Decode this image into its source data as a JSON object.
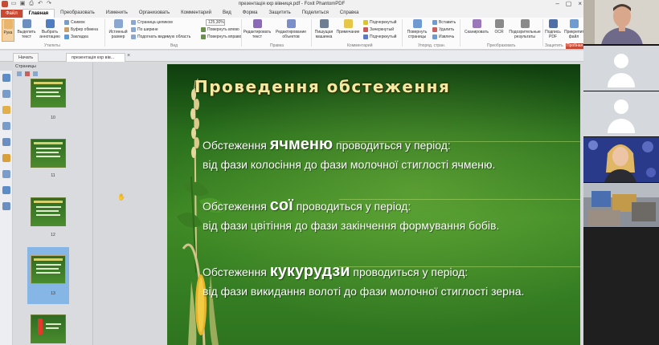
{
  "titlebar": {
    "title": "презентація кхр вівниця.pdf - Foxit PhantomPDF",
    "qa_icons": [
      "open-icon",
      "save-icon",
      "print-icon",
      "undo-icon",
      "redo-icon"
    ]
  },
  "menu": {
    "file": "Файл",
    "tabs": [
      "Главная",
      "Преобразовать",
      "Изменить",
      "Организовать",
      "Комментарий",
      "Вид",
      "Форма",
      "Защитить",
      "Поделиться",
      "Справка"
    ],
    "active": "Главная"
  },
  "ribbon": {
    "hand": "Рука",
    "select_text": "Выделить текст",
    "select_annot": "Выбрать аннотацию",
    "snapshot": "Снимок",
    "clipboard": "Буфер обмена",
    "bookmark": "Закладка",
    "actual_size": "Истинный размер",
    "fit_page": "Страница целиком",
    "fit_width": "По ширине",
    "fit_visible": "Подогнать видимую область",
    "zoom": "125,30%",
    "rotate_left": "Повернуть влево",
    "rotate_right": "Повернуть вправо",
    "edit_text": "Редактировать текст",
    "edit_object": "Редактирование объектов",
    "typewriter": "Пишущая машинка",
    "note": "Примечание",
    "highlight": "Подчеркнутый",
    "strikeout": "Зачеркнутый",
    "underline": "Подчеркнутый",
    "rotate_pages": "Повернуть страницы",
    "insert": "Вставить",
    "delete": "Удалить",
    "extract": "Извлечь",
    "scan": "Сканировать",
    "ocr": "OCR",
    "optimize": "Подозрительные результаты",
    "sign": "Подпись PDF",
    "protect": "Прикрепить файл",
    "groups": [
      "Утилиты",
      "Вид",
      "Правка",
      "Комментарий",
      "Упоряд. стран.",
      "Преобразовать",
      "Защитить"
    ],
    "trial_label": "Пробная"
  },
  "doctabs": [
    "Начать",
    "презентація кхр вів..."
  ],
  "sidebar": {
    "header": "Страницы",
    "pages": [
      "10",
      "11",
      "12",
      "13"
    ],
    "selected": "13"
  },
  "slide": {
    "title": "Проведення обстеження",
    "items": [
      {
        "prefix": "Обстеження ",
        "crop": "ячменю",
        "suffix": " проводиться у період:",
        "detail": "від фази колосіння до фази молочної стиглості ячменю."
      },
      {
        "prefix": "Обстеження ",
        "crop": "сої",
        "suffix": " проводиться у період:",
        "detail": "від фази цвітіння до фази закінчення формування бобів."
      },
      {
        "prefix": "Обстеження ",
        "crop": "кукурудзи",
        "suffix": " проводиться у період:",
        "detail": "від фази викидання волоті до фази молочної стиглості зерна."
      }
    ]
  },
  "colors": {
    "slide_bg": "#2a6f1d",
    "title_color": "#f3e9a0",
    "file_tab": "#c84a34",
    "selected_thumb": "#86b6e6"
  }
}
